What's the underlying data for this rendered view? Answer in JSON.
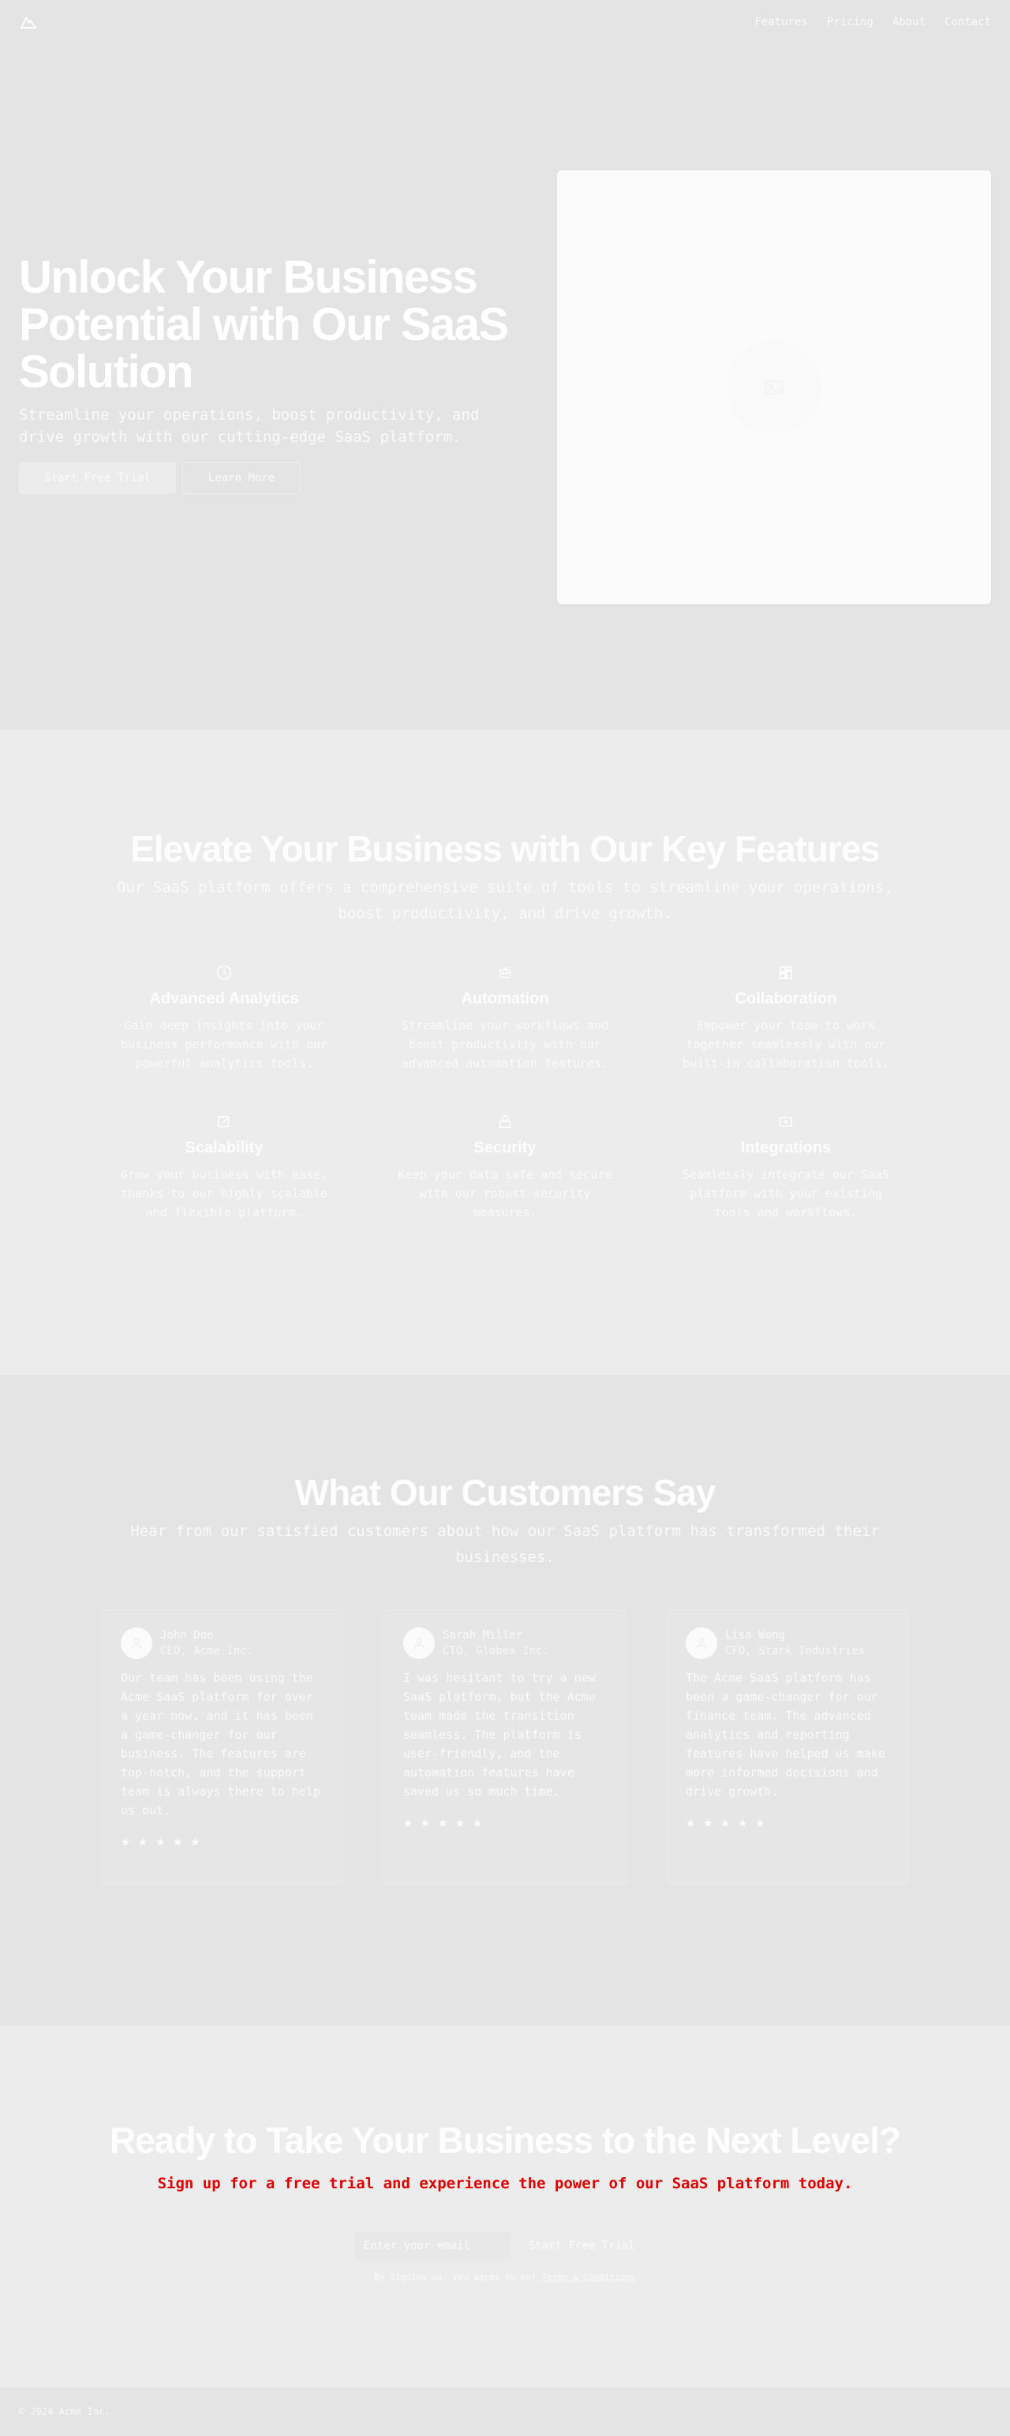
{
  "header": {
    "logo_icon": "mountain-icon",
    "nav": [
      "Features",
      "Pricing",
      "About",
      "Contact"
    ]
  },
  "hero": {
    "title_line1": "Unlock Your Business",
    "title_line2": "Potential with Our SaaS",
    "title_line3": "Solution",
    "subtitle": "Streamline your operations, boost productivity, and drive growth with our cutting-edge SaaS platform.",
    "primary_button": "Start Free Trial",
    "secondary_button": "Learn More",
    "image_icon": "image-placeholder-icon"
  },
  "features": {
    "title": "Elevate Your Business with Our Key Features",
    "subtitle": "Our SaaS platform offers a comprehensive suite of tools to streamline your operations, boost productivity, and drive growth.",
    "items": [
      {
        "icon": "analytics-icon",
        "title": "Advanced Analytics",
        "desc": "Gain deep insights into your business performance with our powerful analytics tools."
      },
      {
        "icon": "bot-icon",
        "title": "Automation",
        "desc": "Streamline your workflows and boost productivity with our advanced automation features."
      },
      {
        "icon": "layout-icon",
        "title": "Collaboration",
        "desc": "Empower your team to work together seamlessly with our built-in collaboration tools."
      },
      {
        "icon": "edit-icon",
        "title": "Scalability",
        "desc": "Grow your business with ease, thanks to our highly scalable and flexible platform."
      },
      {
        "icon": "lock-icon",
        "title": "Security",
        "desc": "Keep your data safe and secure with our robust security measures."
      },
      {
        "icon": "plug-icon",
        "title": "Integrations",
        "desc": "Seamlessly integrate our SaaS platform with your existing tools and workflows."
      }
    ]
  },
  "testimonials": {
    "title": "What Our Customers Say",
    "subtitle": "Hear from our satisfied customers about how our SaaS platform has transformed their businesses.",
    "items": [
      {
        "name": "John Doe",
        "role": "CEO, Acme Inc.",
        "quote": "Our team has been using the Acme SaaS platform for over a year now, and it has been a game-changer for our business. The features are top-notch, and the support team is always there to help us out.",
        "rating": 5
      },
      {
        "name": "Sarah Miller",
        "role": "CTO, Globex Inc.",
        "quote": "I was hesitant to try a new SaaS platform, but the Acme team made the transition seamless. The platform is user-friendly, and the automation features have saved us so much time.",
        "rating": 5
      },
      {
        "name": "Lisa Wong",
        "role": "CFO, Stark Industries",
        "quote": "The Acme SaaS platform has been a game-changer for our finance team. The advanced analytics and reporting features have helped us make more informed decisions and drive growth.",
        "rating": 5
      }
    ],
    "star": "★"
  },
  "cta": {
    "title": "Ready to Take Your Business to the Next Level?",
    "subtitle": "Sign up for a free trial and experience the power of our SaaS platform today.",
    "email_placeholder": "Enter your email",
    "button": "Start Free Trial",
    "note_prefix": "By signing up, you agree to our",
    "note_link": "Terms & Conditions"
  },
  "footer": {
    "copyright": "© 2024 Acme Inc."
  }
}
